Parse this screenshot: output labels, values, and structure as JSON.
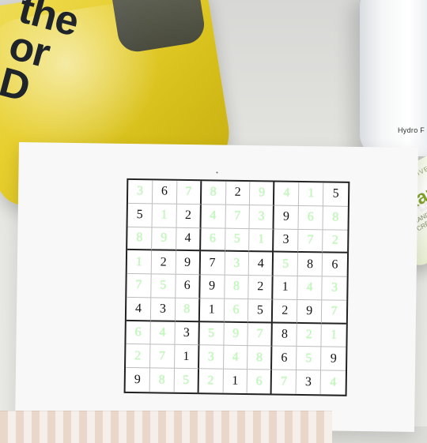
{
  "bag": {
    "text_lines": [
      "the",
      "or",
      "D"
    ]
  },
  "bottle": {
    "brand_text": "Hydro F"
  },
  "tube": {
    "top_text": "INTENSIVE",
    "brand_text": "Kam",
    "sub_text_lines": [
      "HAND C",
      "CRÈME"
    ]
  },
  "sudoku": {
    "cells": [
      {
        "value": "3",
        "color": "green"
      },
      {
        "value": "6",
        "color": "black"
      },
      {
        "value": "7",
        "color": "green"
      },
      {
        "value": "8",
        "color": "green"
      },
      {
        "value": "2",
        "color": "black"
      },
      {
        "value": "9",
        "color": "green"
      },
      {
        "value": "4",
        "color": "green"
      },
      {
        "value": "1",
        "color": "green"
      },
      {
        "value": "5",
        "color": "black"
      },
      {
        "value": "5",
        "color": "black"
      },
      {
        "value": "1",
        "color": "green"
      },
      {
        "value": "2",
        "color": "black"
      },
      {
        "value": "4",
        "color": "green"
      },
      {
        "value": "7",
        "color": "green"
      },
      {
        "value": "3",
        "color": "green"
      },
      {
        "value": "9",
        "color": "black"
      },
      {
        "value": "6",
        "color": "green"
      },
      {
        "value": "8",
        "color": "green"
      },
      {
        "value": "8",
        "color": "green"
      },
      {
        "value": "9",
        "color": "green"
      },
      {
        "value": "4",
        "color": "black"
      },
      {
        "value": "6",
        "color": "green"
      },
      {
        "value": "5",
        "color": "green"
      },
      {
        "value": "1",
        "color": "green"
      },
      {
        "value": "3",
        "color": "black"
      },
      {
        "value": "7",
        "color": "green"
      },
      {
        "value": "2",
        "color": "green"
      },
      {
        "value": "1",
        "color": "green"
      },
      {
        "value": "2",
        "color": "black"
      },
      {
        "value": "9",
        "color": "black"
      },
      {
        "value": "7",
        "color": "black"
      },
      {
        "value": "3",
        "color": "green"
      },
      {
        "value": "4",
        "color": "black"
      },
      {
        "value": "5",
        "color": "green"
      },
      {
        "value": "8",
        "color": "black"
      },
      {
        "value": "6",
        "color": "black"
      },
      {
        "value": "7",
        "color": "green"
      },
      {
        "value": "5",
        "color": "green"
      },
      {
        "value": "6",
        "color": "black"
      },
      {
        "value": "9",
        "color": "black"
      },
      {
        "value": "8",
        "color": "green"
      },
      {
        "value": "2",
        "color": "black"
      },
      {
        "value": "1",
        "color": "black"
      },
      {
        "value": "4",
        "color": "green"
      },
      {
        "value": "3",
        "color": "green"
      },
      {
        "value": "4",
        "color": "black"
      },
      {
        "value": "3",
        "color": "black"
      },
      {
        "value": "8",
        "color": "green"
      },
      {
        "value": "1",
        "color": "black"
      },
      {
        "value": "6",
        "color": "green"
      },
      {
        "value": "5",
        "color": "black"
      },
      {
        "value": "2",
        "color": "black"
      },
      {
        "value": "9",
        "color": "black"
      },
      {
        "value": "7",
        "color": "green"
      },
      {
        "value": "6",
        "color": "green"
      },
      {
        "value": "4",
        "color": "green"
      },
      {
        "value": "3",
        "color": "black"
      },
      {
        "value": "5",
        "color": "green"
      },
      {
        "value": "9",
        "color": "green"
      },
      {
        "value": "7",
        "color": "green"
      },
      {
        "value": "8",
        "color": "black"
      },
      {
        "value": "2",
        "color": "green"
      },
      {
        "value": "1",
        "color": "green"
      },
      {
        "value": "2",
        "color": "green"
      },
      {
        "value": "7",
        "color": "green"
      },
      {
        "value": "1",
        "color": "black"
      },
      {
        "value": "3",
        "color": "green"
      },
      {
        "value": "4",
        "color": "green"
      },
      {
        "value": "8",
        "color": "green"
      },
      {
        "value": "6",
        "color": "black"
      },
      {
        "value": "5",
        "color": "green"
      },
      {
        "value": "9",
        "color": "black"
      },
      {
        "value": "9",
        "color": "black"
      },
      {
        "value": "8",
        "color": "green"
      },
      {
        "value": "5",
        "color": "green"
      },
      {
        "value": "2",
        "color": "green"
      },
      {
        "value": "1",
        "color": "black"
      },
      {
        "value": "6",
        "color": "green"
      },
      {
        "value": "7",
        "color": "green"
      },
      {
        "value": "3",
        "color": "black"
      },
      {
        "value": "4",
        "color": "green"
      }
    ]
  },
  "colors": {
    "green_digit": "#b8ffb0",
    "black_digit": "#111111"
  }
}
